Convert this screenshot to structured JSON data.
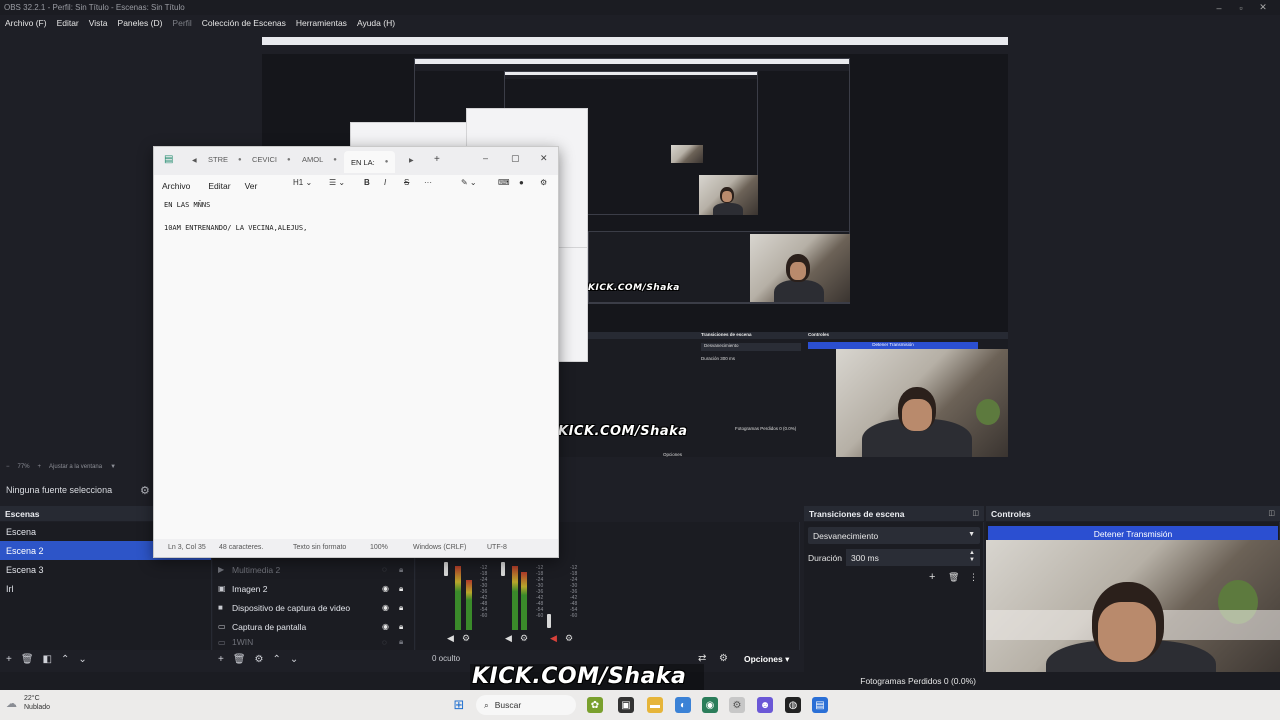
{
  "obs": {
    "title": "OBS 32.2.1 - Perfil: Sin Título - Escenas: Sin Título",
    "menu": [
      "Archivo (F)",
      "Editar",
      "Vista",
      "Paneles (D)",
      "Perfil",
      "Colección de Escenas",
      "Herramientas",
      "Ayuda (H)"
    ],
    "zoom": "77%",
    "fit_label": "Ajustar a la ventana",
    "no_source": "Ninguna fuente selecciona",
    "scenes": {
      "header": "Escenas",
      "items": [
        "Escena",
        "Escena 2",
        "Escena 3",
        "Irl"
      ],
      "selected_index": 1
    },
    "sources": {
      "items": [
        "Multimedia 2",
        "Imagen 2",
        "Dispositivo de captura de video",
        "Captura de pantalla",
        "1WIN"
      ]
    },
    "mixer": {
      "hidden_label": "0 oculto",
      "scale": [
        "-12",
        "-18",
        "-24",
        "-30",
        "-36",
        "-42",
        "-48",
        "-54",
        "-60"
      ]
    },
    "transitions": {
      "header": "Transiciones de escena",
      "selected": "Desvanecimiento",
      "duration_label": "Duración",
      "duration_value": "300 ms"
    },
    "controls": {
      "header": "Controles",
      "stop_stream": "Detener Transmisión"
    },
    "audio_options": "Opciones",
    "dropped_frames": "Fotogramas Perdidos 0 (0.0%)",
    "overlay_text": "KICK.COM/Shaka",
    "preview_small_labels": {
      "transitions": "Transiciones de escena",
      "controls": "Controles",
      "fade": "Desvanecimiento",
      "duration": "Duración",
      "duration_value": "300 ms",
      "stop": "Detener Transmisión",
      "options": "Opciones",
      "dropped": "Fotogramas Perdidos 0 (0.0%)"
    }
  },
  "notepad": {
    "tabs": [
      "STRE",
      "CEVICI",
      "AMOL",
      "EN LA:"
    ],
    "active_tab_index": 3,
    "menu": [
      "Archivo",
      "Editar",
      "Ver"
    ],
    "heading_tool": "H1",
    "lines": [
      "EN LAS MÑNS",
      "10AM ENTRENANDO/ LA VECINA,ALEJUS,"
    ],
    "status": {
      "position": "Ln 3, Col 35",
      "chars": "48 caracteres.",
      "format": "Texto sin formato",
      "zoom": "100%",
      "eol": "Windows (CRLF)",
      "encoding": "UTF-8"
    }
  },
  "taskbar": {
    "temperature": "22°C",
    "condition": "Nublado",
    "search": "Buscar"
  },
  "colors": {
    "accent": "#2b4fd1",
    "dock_bg": "#1b1c22",
    "header_bg": "#272a33"
  }
}
